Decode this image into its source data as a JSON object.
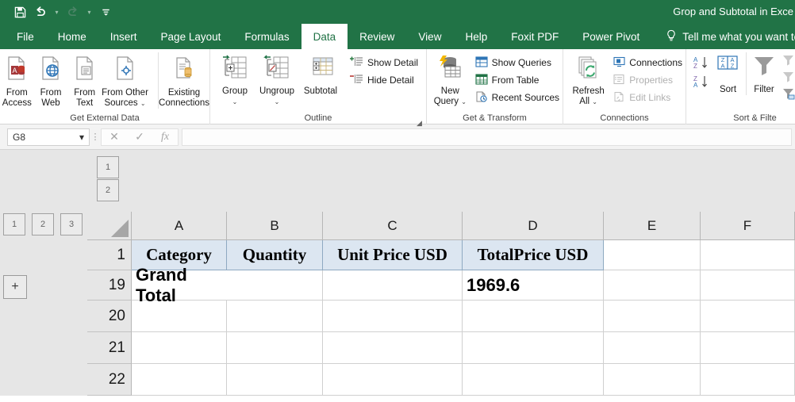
{
  "titlebar": {
    "document_title": "Grop and Subtotal in Exce",
    "qat": [
      {
        "name": "save-icon",
        "label": "Save"
      },
      {
        "name": "undo-icon",
        "label": "Undo"
      },
      {
        "name": "redo-icon",
        "label": "Redo"
      },
      {
        "name": "customize-quick-access-toolbar-icon",
        "label": "Customize Quick Access Toolbar"
      }
    ]
  },
  "tabs": [
    {
      "label": "File",
      "active": false
    },
    {
      "label": "Home",
      "active": false
    },
    {
      "label": "Insert",
      "active": false
    },
    {
      "label": "Page Layout",
      "active": false
    },
    {
      "label": "Formulas",
      "active": false
    },
    {
      "label": "Data",
      "active": true
    },
    {
      "label": "Review",
      "active": false
    },
    {
      "label": "View",
      "active": false
    },
    {
      "label": "Help",
      "active": false
    },
    {
      "label": "Foxit PDF",
      "active": false
    },
    {
      "label": "Power Pivot",
      "active": false
    }
  ],
  "tellme": {
    "label": "Tell me what you want to do",
    "icon": "lightbulb-icon"
  },
  "ribbon": {
    "groups": [
      {
        "name": "get-external-data",
        "label": "Get External Data",
        "buttons": [
          {
            "label": "From Access",
            "line1": "From",
            "line2": "Access",
            "caret": false
          },
          {
            "label": "From Web",
            "line1": "From",
            "line2": "Web",
            "caret": false
          },
          {
            "label": "From Text",
            "line1": "From",
            "line2": "Text",
            "caret": false
          },
          {
            "label": "From Other Sources",
            "line1": "From Other",
            "line2": "Sources",
            "caret": true
          },
          {
            "label": "Existing Connections",
            "line1": "Existing",
            "line2": "Connections",
            "caret": false
          }
        ]
      },
      {
        "name": "outline",
        "label": "Outline",
        "buttons": [
          {
            "label": "Group",
            "line1": "Group",
            "line2": "",
            "caret": true
          },
          {
            "label": "Ungroup",
            "line1": "Ungroup",
            "line2": "",
            "caret": true
          },
          {
            "label": "Subtotal",
            "line1": "Subtotal",
            "line2": "",
            "caret": false
          }
        ],
        "small_buttons": [
          {
            "label": "Show Detail",
            "disabled": false
          },
          {
            "label": "Hide Detail",
            "disabled": false
          }
        ],
        "has_launcher": true
      },
      {
        "name": "get-and-transform",
        "label": "Get & Transform",
        "buttons": [
          {
            "label": "New Query",
            "line1": "New",
            "line2": "Query",
            "caret": true
          }
        ],
        "small_buttons": [
          {
            "label": "Show Queries",
            "disabled": false
          },
          {
            "label": "From Table",
            "disabled": false
          },
          {
            "label": "Recent Sources",
            "disabled": false
          }
        ]
      },
      {
        "name": "connections",
        "label": "Connections",
        "buttons": [
          {
            "label": "Refresh All",
            "line1": "Refresh",
            "line2": "All",
            "caret": true
          }
        ],
        "small_buttons": [
          {
            "label": "Connections",
            "disabled": false
          },
          {
            "label": "Properties",
            "disabled": true
          },
          {
            "label": "Edit Links",
            "disabled": true
          }
        ]
      },
      {
        "name": "sort-and-filter",
        "label": "Sort & Filte",
        "buttons": [
          {
            "label": "Sort",
            "line1": "Sort",
            "line2": "",
            "caret": false
          },
          {
            "label": "Filter",
            "line1": "Filter",
            "line2": "",
            "caret": false
          }
        ]
      }
    ]
  },
  "formula_bar": {
    "name_box_value": "G8",
    "formula_value": "",
    "cancel_icon": "✕",
    "enter_icon": "✓",
    "function_icon": "fx"
  },
  "outline": {
    "column_levels": [
      "1",
      "2"
    ],
    "row_levels": [
      "1",
      "2",
      "3"
    ],
    "collapse_button": "minus-button",
    "expand_button": "+"
  },
  "sheet": {
    "column_headers": [
      "A",
      "B",
      "C",
      "D",
      "E",
      "F"
    ],
    "row_headers": [
      "1",
      "19",
      "20",
      "21",
      "22"
    ],
    "rows": [
      {
        "row": "1",
        "cells": [
          "Category",
          "Quantity",
          "Unit Price USD",
          "TotalPrice USD",
          "",
          ""
        ],
        "is_header": true
      },
      {
        "row": "19",
        "cells": [
          "Grand Total",
          "",
          "",
          "1969.6",
          "",
          ""
        ],
        "is_header": false
      },
      {
        "row": "20",
        "cells": [
          "",
          "",
          "",
          "",
          "",
          ""
        ],
        "is_header": false
      },
      {
        "row": "21",
        "cells": [
          "",
          "",
          "",
          "",
          "",
          ""
        ],
        "is_header": false
      },
      {
        "row": "22",
        "cells": [
          "",
          "",
          "",
          "",
          "",
          ""
        ],
        "is_header": false
      }
    ]
  },
  "colors": {
    "excel_green": "#217346",
    "header_fill": "#dce6f1",
    "outline_gray": "#e6e6e6"
  }
}
